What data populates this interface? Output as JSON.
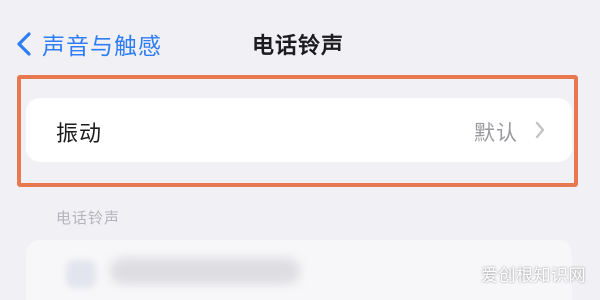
{
  "nav": {
    "back_label": "声音与触感",
    "title": "电话铃声"
  },
  "vibration_row": {
    "label": "振动",
    "value": "默认"
  },
  "section": {
    "header": "电话铃声"
  },
  "watermark": "爱创根知识网",
  "colors": {
    "accent": "#2f7df6",
    "highlight_border": "#e8784f",
    "background": "#f1f1f5"
  }
}
